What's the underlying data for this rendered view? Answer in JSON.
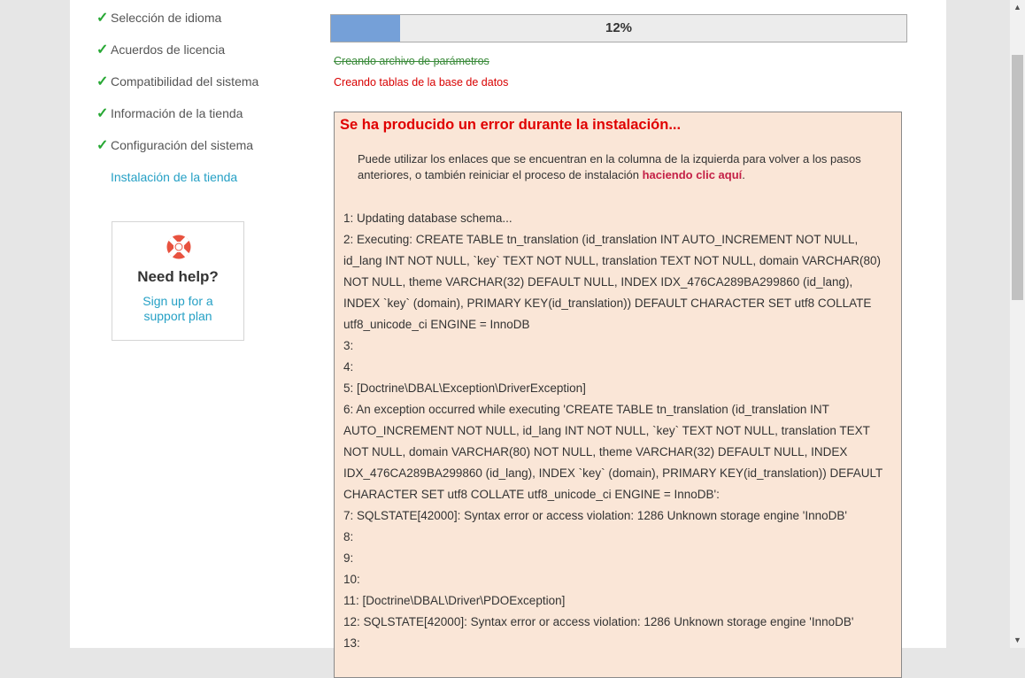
{
  "steps": [
    {
      "label": "Selección de idioma",
      "done": true
    },
    {
      "label": "Acuerdos de licencia",
      "done": true
    },
    {
      "label": "Compatibilidad del sistema",
      "done": true
    },
    {
      "label": "Información de la tienda",
      "done": true
    },
    {
      "label": "Configuración del sistema",
      "done": true
    },
    {
      "label": "Instalación de la tienda",
      "done": false
    }
  ],
  "help": {
    "title": "Need help?",
    "link_line1": "Sign up for a",
    "link_line2": "support plan",
    "icon": "lifebuoy-icon"
  },
  "progress": {
    "value": 0.12,
    "label": "12%"
  },
  "tasks": {
    "done": "Creando archivo de parámetros",
    "running": "Creando tablas de la base de datos"
  },
  "error": {
    "title": "Se ha producido un error durante la instalación...",
    "message": "Puede utilizar los enlaces que se encuentran en la columna de la izquierda para volver a los pasos anteriores, o también reiniciar el proceso de instalación ",
    "link_text": "haciendo clic aquí",
    "message_end": "."
  },
  "log": [
    "1: Updating database schema...",
    "2: Executing: CREATE TABLE tn_translation (id_translation INT AUTO_INCREMENT NOT NULL, id_lang INT NOT NULL, `key` TEXT NOT NULL, translation TEXT NOT NULL, domain VARCHAR(80) NOT NULL, theme VARCHAR(32) DEFAULT NULL, INDEX IDX_476CA289BA299860 (id_lang), INDEX `key` (domain), PRIMARY KEY(id_translation)) DEFAULT CHARACTER SET utf8 COLLATE utf8_unicode_ci ENGINE = InnoDB",
    "3:",
    "4:",
    "5: [Doctrine\\DBAL\\Exception\\DriverException]",
    "6: An exception occurred while executing 'CREATE TABLE tn_translation (id_translation INT AUTO_INCREMENT NOT NULL, id_lang INT NOT NULL, `key` TEXT NOT NULL, translation TEXT NOT NULL, domain VARCHAR(80) NOT NULL, theme VARCHAR(32) DEFAULT NULL, INDEX IDX_476CA289BA299860 (id_lang), INDEX `key` (domain), PRIMARY KEY(id_translation)) DEFAULT CHARACTER SET utf8 COLLATE utf8_unicode_ci ENGINE = InnoDB':",
    "7: SQLSTATE[42000]: Syntax error or access violation: 1286 Unknown storage engine 'InnoDB'",
    "8:",
    "9:",
    "10:",
    "11: [Doctrine\\DBAL\\Driver\\PDOException]",
    "12: SQLSTATE[42000]: Syntax error or access violation: 1286 Unknown storage engine 'InnoDB'",
    "13:"
  ],
  "colors": {
    "check": "#27a834",
    "accent": "#25a0c5",
    "error_bg": "#fae6d7",
    "error_title": "#e00000",
    "progress_fill": "#75a0d8"
  }
}
